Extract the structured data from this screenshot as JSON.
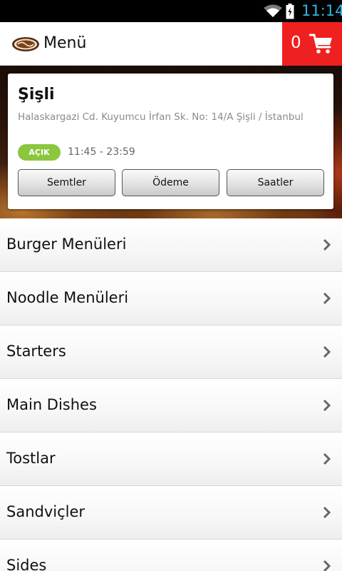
{
  "status_bar": {
    "time": "11:14",
    "icons": [
      "wifi-icon",
      "battery-charging-icon"
    ]
  },
  "action_bar": {
    "logo_icon": "cheers-logo",
    "title": "Menü",
    "cart_count": "0",
    "cart_icon": "cart-icon",
    "cart_color": "#ef2020"
  },
  "branch": {
    "name": "Şişli",
    "address": "Halaskargazi Cd. Kuyumcu İrfan Sk. No: 14/A Şişli / İstanbul",
    "status": "AÇIK",
    "status_color": "#8cc63e",
    "hours": "11:45 - 23:59",
    "buttons": [
      "Semtler",
      "Ödeme",
      "Saatler"
    ]
  },
  "menu": {
    "items": [
      {
        "label": "Burger Menüleri"
      },
      {
        "label": "Noodle Menüleri"
      },
      {
        "label": "Starters"
      },
      {
        "label": "Main Dishes"
      },
      {
        "label": "Tostlar"
      },
      {
        "label": "Sandviçler"
      },
      {
        "label": "Sides"
      }
    ]
  }
}
